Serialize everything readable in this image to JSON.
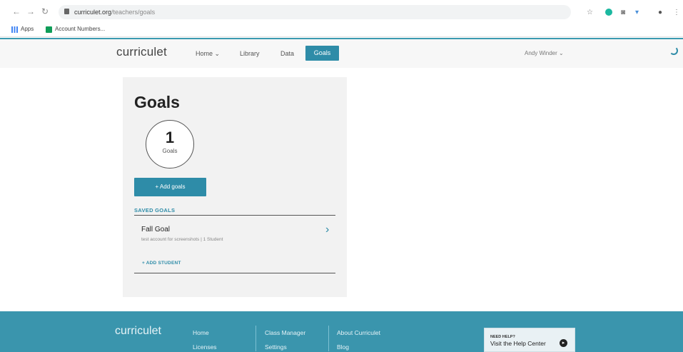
{
  "browser": {
    "url_domain": "curriculet.org",
    "url_path": "/teachers/goals",
    "bookmarks": [
      "Apps",
      "Account Numbers..."
    ]
  },
  "header": {
    "logo": "curriculet",
    "nav": {
      "home": "Home ⌄",
      "library": "Library",
      "data": "Data",
      "goals": "Goals"
    },
    "user": "Andy Winder ⌄"
  },
  "goals_card": {
    "title": "Goals",
    "count": "1",
    "count_label": "Goals",
    "add_button": "+ Add goals",
    "saved_header": "SAVED GOALS",
    "saved_goals": [
      {
        "name": "Fall Goal",
        "subtitle": "test account for screenshots | 1 Student"
      }
    ],
    "add_student": "+ ADD STUDENT"
  },
  "footer": {
    "logo": "curriculet",
    "col1": [
      "Home",
      "Licenses"
    ],
    "col2": [
      "Class Manager",
      "Settings"
    ],
    "col3": [
      "About Curriculet",
      "Blog"
    ],
    "help_small": "NEED HELP?",
    "help_big": "Visit the Help Center"
  },
  "colors": {
    "accent": "#2e8ca8",
    "footer_bg": "#3a95ad",
    "card_bg": "#f2f2f2"
  }
}
